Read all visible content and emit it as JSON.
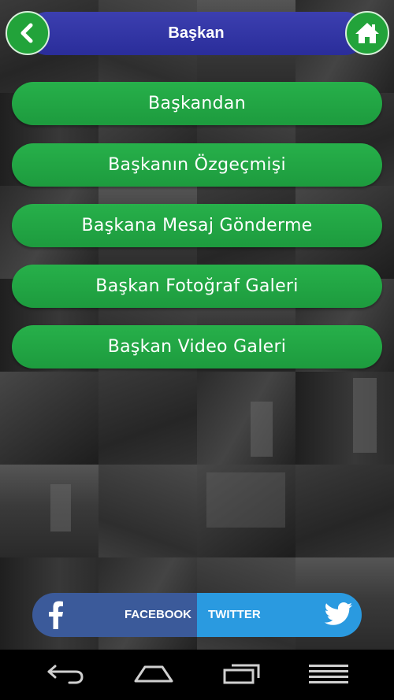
{
  "header": {
    "title": "Başkan",
    "back_icon": "chevron-left-icon",
    "home_icon": "home-icon"
  },
  "menu": {
    "items": [
      {
        "label": "Başkandan"
      },
      {
        "label": "Başkanın Özgeçmişi"
      },
      {
        "label": "Başkana Mesaj Gönderme"
      },
      {
        "label": "Başkan Fotoğraf Galeri"
      },
      {
        "label": "Başkan Video Galeri"
      }
    ]
  },
  "social": {
    "facebook_label": "FACEBOOK",
    "twitter_label": "TWITTER",
    "facebook_icon": "facebook-icon",
    "twitter_icon": "twitter-bird-icon"
  },
  "navbar": {
    "back_icon": "nav-back-icon",
    "home_icon": "nav-home-icon",
    "recents_icon": "nav-recents-icon",
    "menu_icon": "nav-menu-icon"
  },
  "colors": {
    "header_blue": "#2e31a3",
    "button_green": "#22a33a",
    "facebook_blue": "#3b5a9a",
    "twitter_blue": "#2a9ae0"
  }
}
